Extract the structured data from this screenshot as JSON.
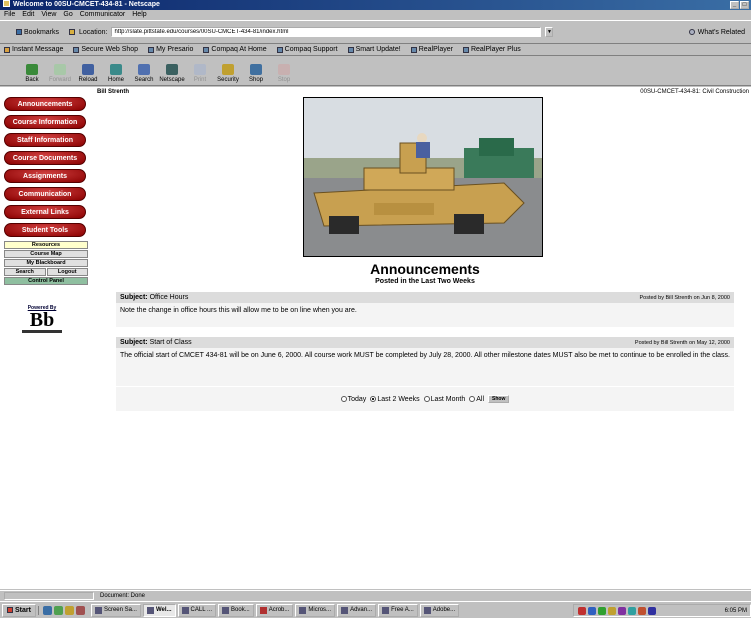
{
  "window": {
    "title": "Welcome to 00SU-CMCET-434-81 - Netscape"
  },
  "menu": [
    "File",
    "Edit",
    "View",
    "Go",
    "Communicator",
    "Help"
  ],
  "location_bar": {
    "bookmarks_label": "Bookmarks",
    "location_label": "Location:",
    "url": "http://slate.pittstate.edu/courses/00SU-CMCET-434-81/index.html",
    "related_label": "What's Related"
  },
  "personal_toolbar": [
    "Instant Message",
    "Secure Web Shop",
    "My Presario",
    "Compaq At Home",
    "Compaq Support",
    "Smart Update!",
    "RealPlayer",
    "RealPlayer Plus"
  ],
  "nav_toolbar": [
    {
      "label": "Back",
      "enabled": true
    },
    {
      "label": "Forward",
      "enabled": false
    },
    {
      "label": "Reload",
      "enabled": true
    },
    {
      "label": "Home",
      "enabled": true
    },
    {
      "label": "Search",
      "enabled": true
    },
    {
      "label": "Netscape",
      "enabled": true
    },
    {
      "label": "Print",
      "enabled": false
    },
    {
      "label": "Security",
      "enabled": true
    },
    {
      "label": "Shop",
      "enabled": true
    },
    {
      "label": "Stop",
      "enabled": false
    }
  ],
  "page": {
    "instructor": "Bill Strenth",
    "course_label": "00SU-CMCET-434-81: Civil Construction",
    "heading": "Announcements",
    "subheading": "Posted in the Last Two Weeks"
  },
  "sidebar": {
    "main_buttons": [
      "Announcements",
      "Course Information",
      "Staff Information",
      "Course Documents",
      "Assignments",
      "Communication",
      "External Links",
      "Student Tools"
    ],
    "resources": "Resources",
    "course_map": "Course Map",
    "my_blackboard": "My Blackboard",
    "search": "Search",
    "logout": "Logout",
    "control_panel": "Control Panel",
    "powered_by": "Powered By",
    "logo_text": "Bb"
  },
  "announcements": [
    {
      "subject_label": "Subject:",
      "subject": "Office Hours",
      "posted": "Posted by Bill Strenth on Jun 8, 2000",
      "body": "Note the change in office hours this will allow me to be on line when you are."
    },
    {
      "subject_label": "Subject:",
      "subject": "Start of Class",
      "posted": "Posted by Bill Strenth on May 12, 2000",
      "body": "The official start of CMCET 434-81 will be on June 6, 2000. All course work MUST be completed by July 28, 2000. All other milestone dates MUST also be met to continue to be enrolled in the class."
    }
  ],
  "filter": {
    "options": [
      "Today",
      "Last 2 Weeks",
      "Last Month",
      "All"
    ],
    "selected": "Last 2 Weeks",
    "button": "Show"
  },
  "status": {
    "text": "Document: Done"
  },
  "taskbar": {
    "start": "Start",
    "tasks": [
      "Screen Sa...",
      "Wel...",
      "CALL ...",
      "Book...",
      "Acrob...",
      "Micros...",
      "Advan...",
      "Free A...",
      "Adobe..."
    ],
    "active_task": "Wel...",
    "clock": "6:05 PM"
  }
}
